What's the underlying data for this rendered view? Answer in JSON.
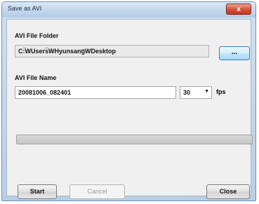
{
  "window": {
    "title": "Save as AVI",
    "close_glyph": "x"
  },
  "folder": {
    "label": "AVI File Folder",
    "path": "C:̅WUsers̅WHyunsang̅WDesktop",
    "browse_label": "..."
  },
  "file": {
    "label": "AVI File Name",
    "name": "20081006_082401",
    "fps_value": "30",
    "fps_label": "fps"
  },
  "progress": {
    "value": 0
  },
  "buttons": {
    "start": "Start",
    "cancel": "Cancel",
    "close": "Close"
  }
}
